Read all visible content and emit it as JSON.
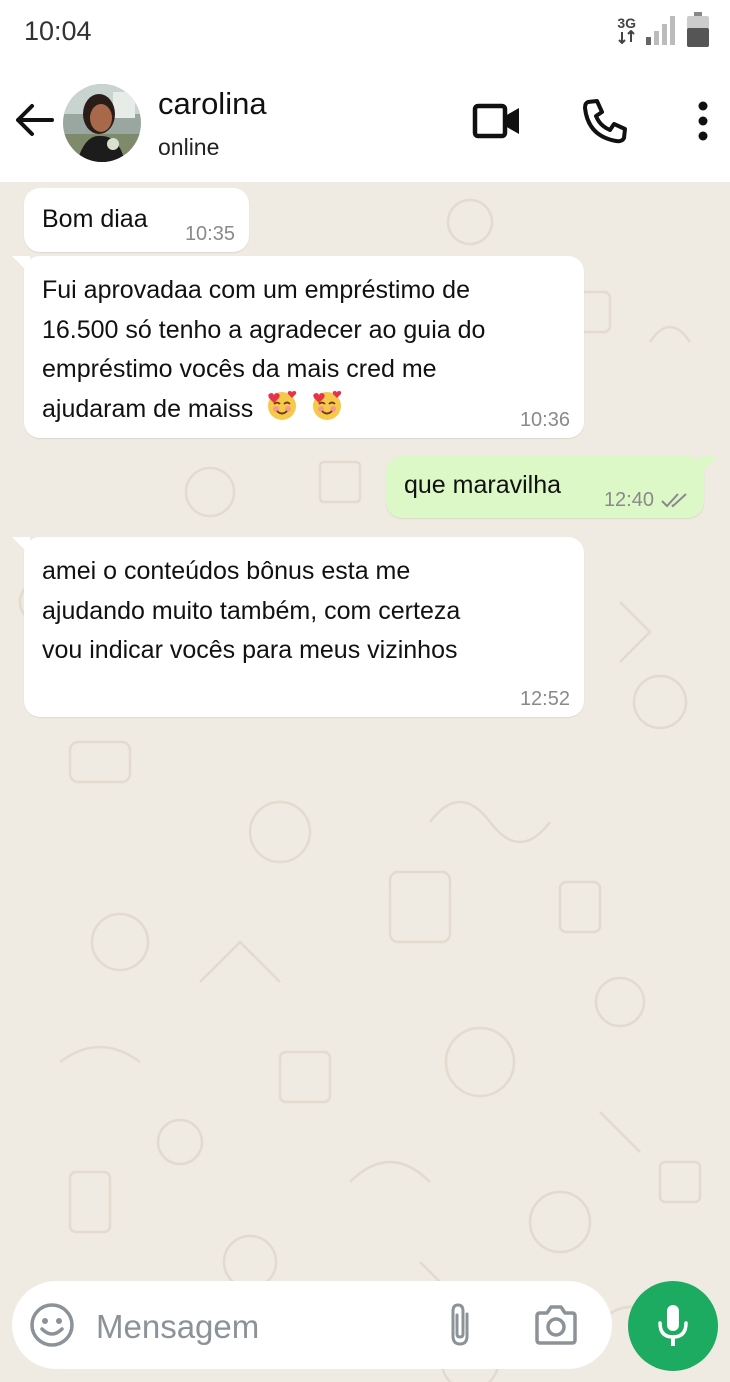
{
  "status_bar": {
    "time": "10:04",
    "network": "3G"
  },
  "header": {
    "contact_name": "carolina",
    "contact_status": "online",
    "icons": [
      "back-arrow-icon",
      "video-call-icon",
      "phone-icon",
      "more-vert-icon"
    ]
  },
  "messages": [
    {
      "direction": "in",
      "lines": [
        "Bom diaa"
      ],
      "time": "10:35"
    },
    {
      "direction": "in",
      "lines": [
        "Fui aprovadaa com um empréstimo de",
        "16.500 só tenho a agradecer ao guia do",
        "empréstimo vocês da mais cred me",
        "ajudaram de maiss"
      ],
      "emoji": "smiling-face-with-hearts",
      "time": "10:36"
    },
    {
      "direction": "out",
      "lines": [
        "que maravilha"
      ],
      "time": "12:40",
      "status": "read-double-check"
    },
    {
      "direction": "in",
      "lines": [
        "amei o conteúdos bônus esta me",
        "ajudando muito também, com certeza",
        "vou indicar vocês para meus vizinhos"
      ],
      "time": "12:52"
    }
  ],
  "composer": {
    "placeholder": "Mensagem",
    "icons": [
      "emoji-icon",
      "attach-icon",
      "camera-icon",
      "mic-icon"
    ]
  },
  "colors": {
    "chat_background": "#efeae2",
    "incoming_bubble": "#ffffff",
    "outgoing_bubble": "#dcf8c6",
    "mic_button": "#1daa61"
  }
}
